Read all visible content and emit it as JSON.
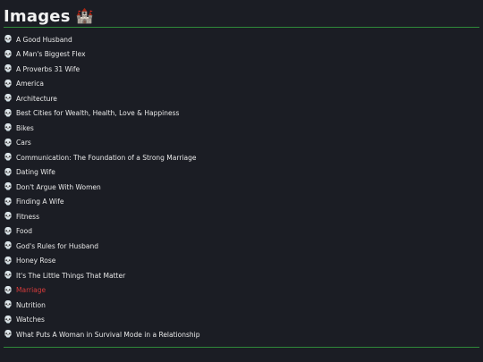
{
  "page": {
    "title": "Images",
    "title_emoji": "🏰"
  },
  "colors": {
    "background": "#1b1d24",
    "text": "#e8e8e8",
    "active_link": "#d63b3b",
    "rule": "#2f8a3a"
  },
  "list": {
    "bullet_icon": "skull-icon",
    "bullet_glyph": "💀",
    "items": [
      {
        "label": "A Good Husband",
        "active": false
      },
      {
        "label": "A Man's Biggest Flex",
        "active": false
      },
      {
        "label": "A Proverbs 31 Wife",
        "active": false
      },
      {
        "label": "America",
        "active": false
      },
      {
        "label": "Architecture",
        "active": false
      },
      {
        "label": "Best Cities for Wealth, Health, Love & Happiness",
        "active": false
      },
      {
        "label": "Bikes",
        "active": false
      },
      {
        "label": "Cars",
        "active": false
      },
      {
        "label": "Communication: The Foundation of a Strong Marriage",
        "active": false
      },
      {
        "label": "Dating Wife",
        "active": false
      },
      {
        "label": "Don't Argue With Women",
        "active": false
      },
      {
        "label": "Finding A Wife",
        "active": false
      },
      {
        "label": "Fitness",
        "active": false
      },
      {
        "label": "Food",
        "active": false
      },
      {
        "label": "God's Rules for Husband",
        "active": false
      },
      {
        "label": "Honey Rose",
        "active": false
      },
      {
        "label": "It's The Little Things That Matter",
        "active": false
      },
      {
        "label": "Marriage",
        "active": true
      },
      {
        "label": "Nutrition",
        "active": false
      },
      {
        "label": "Watches",
        "active": false
      },
      {
        "label": "What Puts A Woman in Survival Mode in a Relationship",
        "active": false
      }
    ]
  }
}
